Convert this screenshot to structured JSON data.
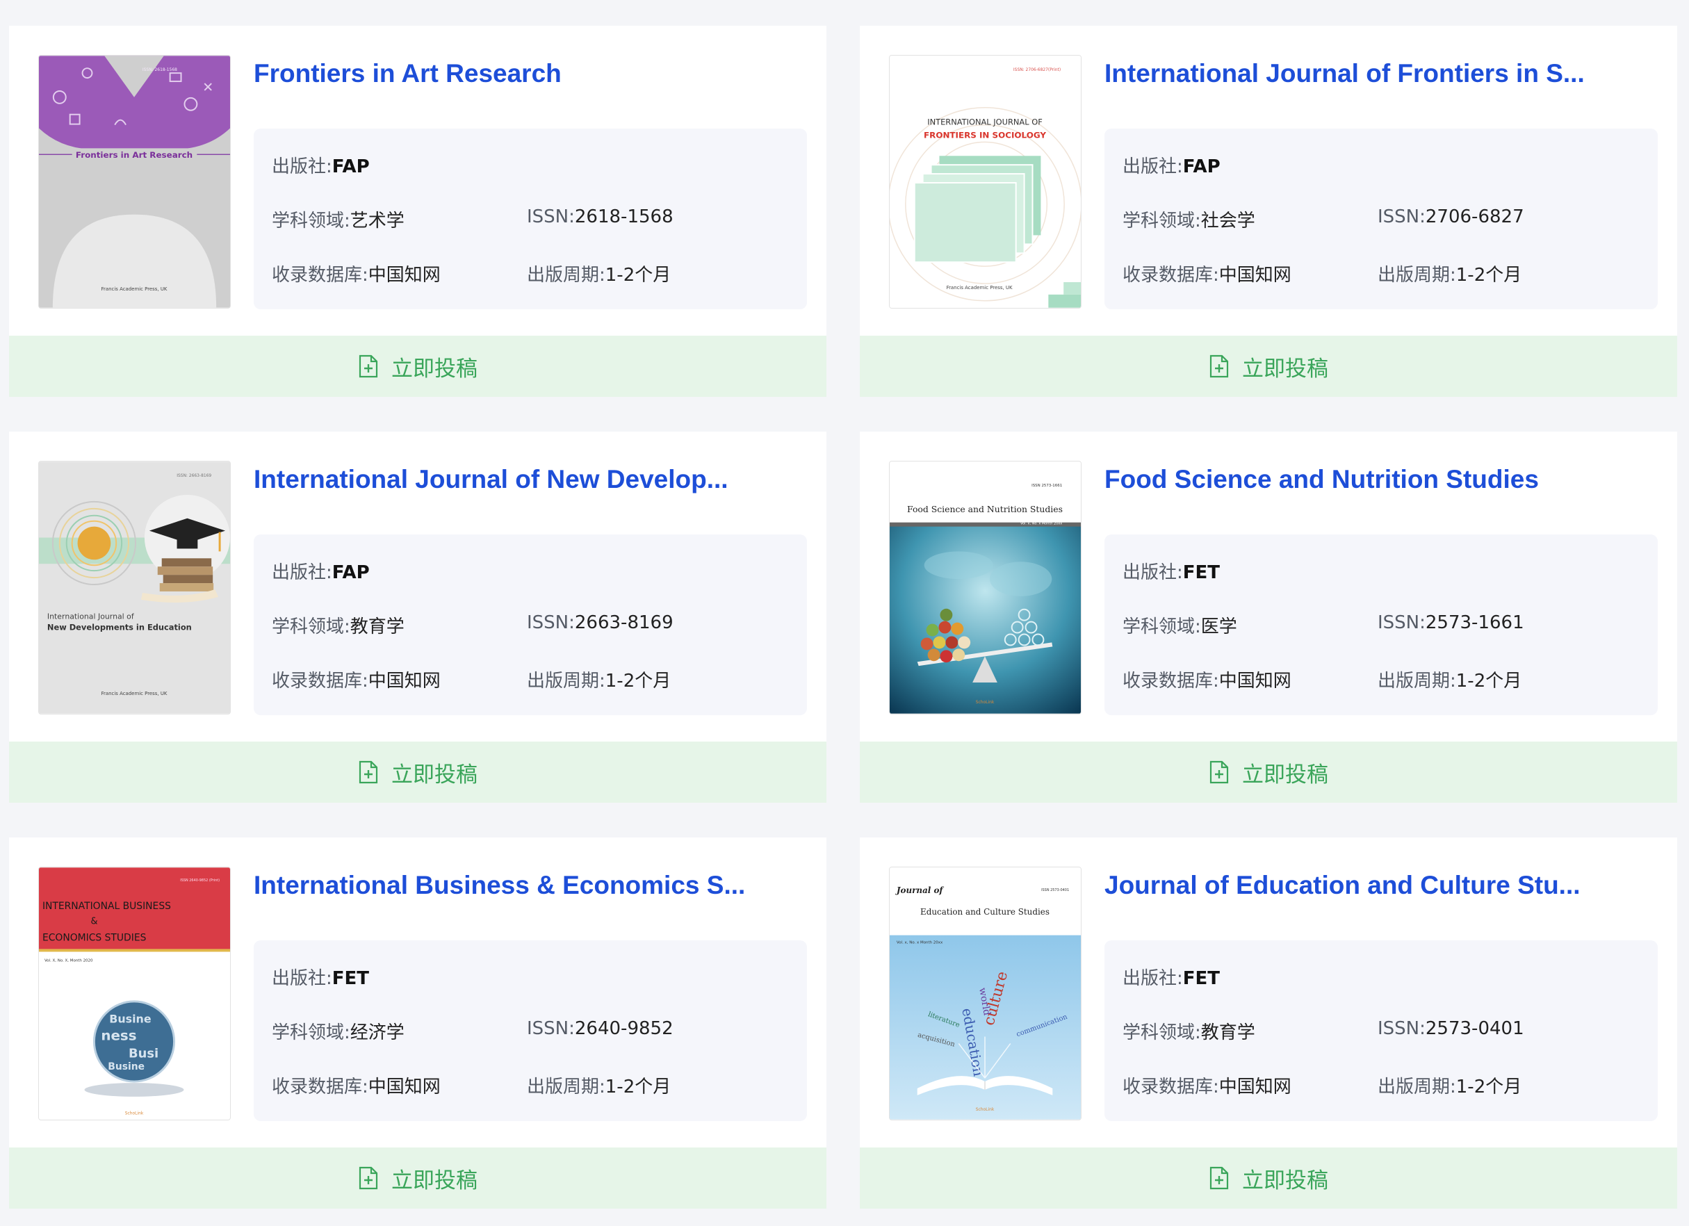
{
  "labels": {
    "publisher": "出版社:",
    "field": "学科领域:",
    "issn": "ISSN:",
    "database": "收录数据库:",
    "cycle": "出版周期:",
    "submit": "立即投稿"
  },
  "colors": {
    "title": "#1d4ed8",
    "submit_bg": "#e6f5e8",
    "submit_text": "#3aa55a",
    "info_bg": "#f5f6fb"
  },
  "journals": [
    {
      "title": "Frontiers in Art Research",
      "publisher": "FAP",
      "field": "艺术学",
      "issn": "2618-1568",
      "database": "中国知网",
      "cycle": "1-2个月",
      "cover": {
        "title": "Frontiers in Art Research",
        "issn_line": "ISSN: 2618-1568",
        "publisher_line": "Francis Academic Press, UK"
      }
    },
    {
      "title": "International Journal of Frontiers in S...",
      "publisher": "FAP",
      "field": "社会学",
      "issn": "2706-6827",
      "database": "中国知网",
      "cycle": "1-2个月",
      "cover": {
        "title_line1": "INTERNATIONAL JOURNAL OF",
        "title_line2": "FRONTIERS IN SOCIOLOGY",
        "issn_line": "ISSN: 2706-6827(Print)",
        "publisher_line": "Francis Academic Press, UK"
      }
    },
    {
      "title": "International Journal of New Develop...",
      "publisher": "FAP",
      "field": "教育学",
      "issn": "2663-8169",
      "database": "中国知网",
      "cycle": "1-2个月",
      "cover": {
        "title_line1": "International Journal of",
        "title_line2": "New Developments in Education",
        "issn_line": "ISSN: 2663-8169",
        "publisher_line": "Francis Academic Press, UK"
      }
    },
    {
      "title": "Food Science and Nutrition Studies",
      "publisher": "FET",
      "field": "医学",
      "issn": "2573-1661",
      "database": "中国知网",
      "cycle": "1-2个月",
      "cover": {
        "title": "Food Science and Nutrition Studies",
        "issue_line": "Vol. x, No. x Month 20xx",
        "brand": "SchoLink"
      }
    },
    {
      "title": "International Business & Economics S...",
      "publisher": "FET",
      "field": "经济学",
      "issn": "2640-9852",
      "database": "中国知网",
      "cycle": "1-2个月",
      "cover": {
        "title_line1": "INTERNATIONAL BUSINESS",
        "title_line2": "&",
        "title_line3": "ECONOMICS STUDIES",
        "issue_line": "Vol. X, No. X, Month 2020",
        "brand": "SchoLink"
      }
    },
    {
      "title": "Journal of Education and Culture Stu...",
      "publisher": "FET",
      "field": "教育学",
      "issn": "2573-0401",
      "database": "中国知网",
      "cycle": "1-2个月",
      "cover": {
        "title_script": "Journal of",
        "title": "Education and Culture Studies",
        "issue_line": "Vol. x, No. x Month 20xx",
        "brand": "SchoLink"
      }
    }
  ]
}
